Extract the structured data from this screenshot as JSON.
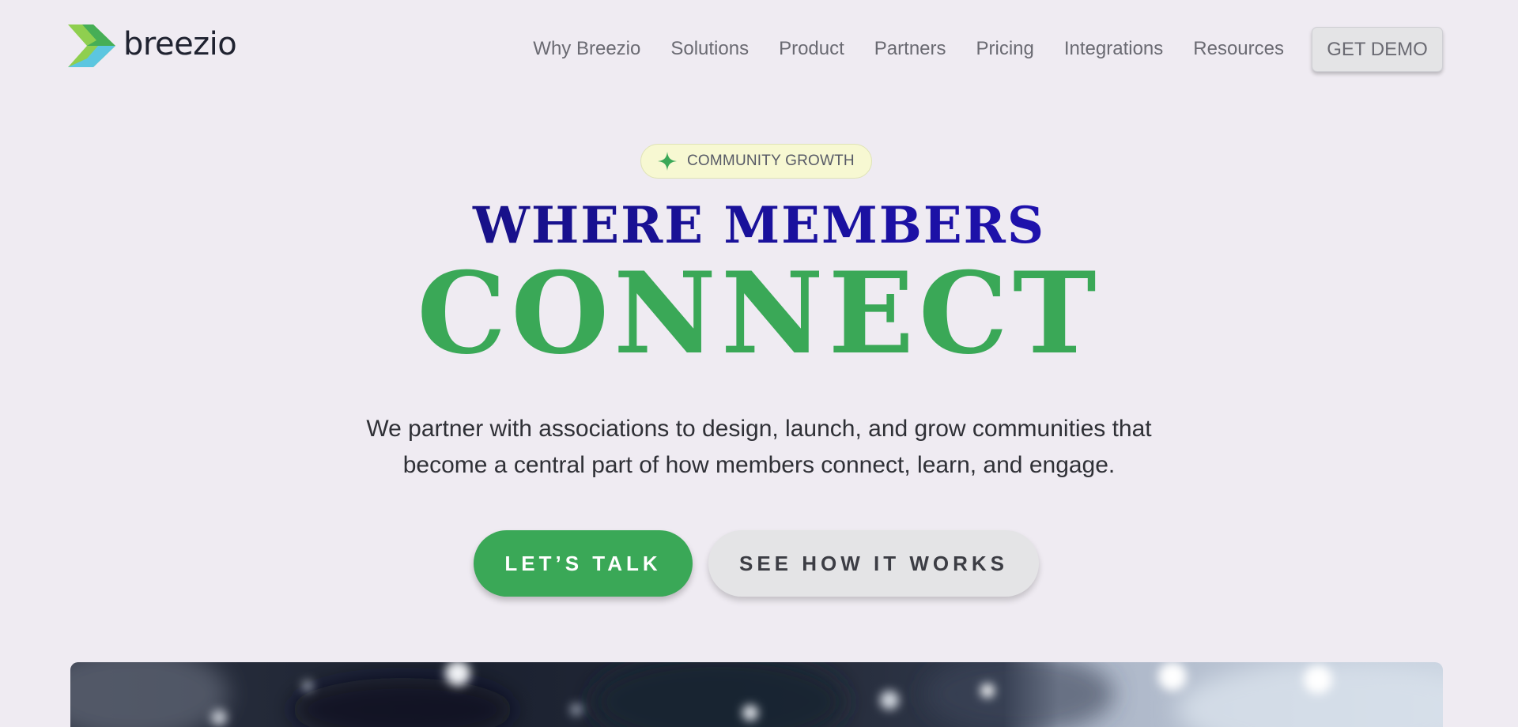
{
  "brand": {
    "name": "breezio",
    "logo_icon": "breezio-chevron-logo",
    "colors": {
      "green": "#3aa857",
      "navy": "#14106a",
      "blue": "#2a12c9",
      "background": "#efebf2"
    }
  },
  "nav": {
    "items": [
      {
        "label": "Why Breezio"
      },
      {
        "label": "Solutions"
      },
      {
        "label": "Product"
      },
      {
        "label": "Partners"
      },
      {
        "label": "Pricing"
      },
      {
        "label": "Integrations"
      },
      {
        "label": "Resources"
      }
    ],
    "cta_label": "GET DEMO"
  },
  "hero": {
    "badge": {
      "icon": "sparkle-icon",
      "label": "COMMUNITY GROWTH"
    },
    "headline_top": "WHERE MEMBERS",
    "headline_bottom": "CONNECT",
    "subtitle_line1": "We partner with associations to design, launch, and grow communities that",
    "subtitle_line2": "become a central part of how members connect, learn, and engage.",
    "primary_cta": "LET’S TALK",
    "secondary_cta": "SEE HOW IT WORKS"
  }
}
